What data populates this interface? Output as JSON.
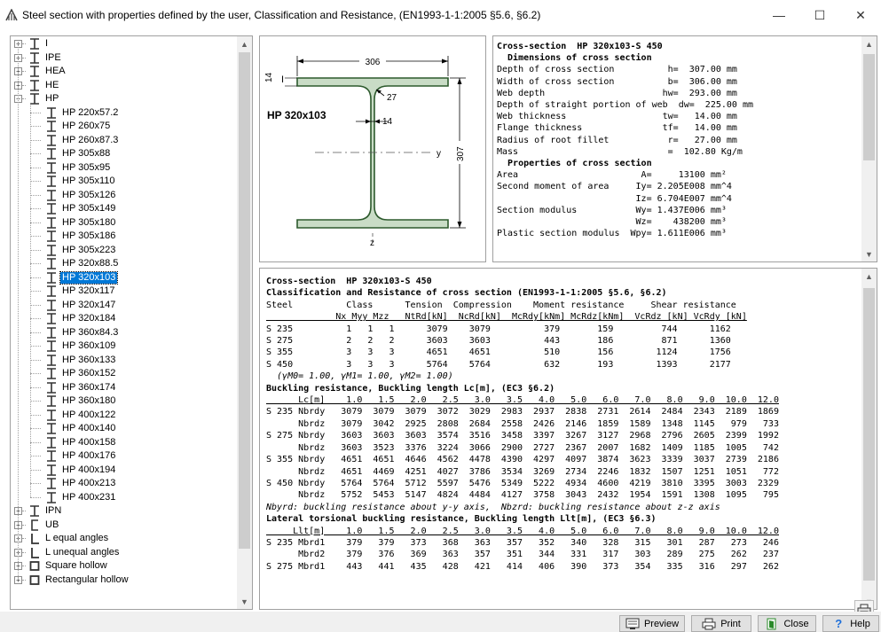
{
  "window": {
    "title": "Steel section with properties defined by the user, Classification and Resistance, (EN1993-1-1:2005 §5.6, §6.2)",
    "minimize_glyph": "—",
    "maximize_glyph": "☐",
    "close_glyph": "✕"
  },
  "tree": {
    "items": [
      {
        "label": "I",
        "level": 0,
        "toggle": "+",
        "icon": "i-beam-icon"
      },
      {
        "label": "IPE",
        "level": 0,
        "toggle": "+",
        "icon": "i-beam-icon"
      },
      {
        "label": "HEA",
        "level": 0,
        "toggle": "+",
        "icon": "i-beam-icon"
      },
      {
        "label": "HE",
        "level": 0,
        "toggle": "+",
        "icon": "i-beam-icon"
      },
      {
        "label": "HP",
        "level": 0,
        "toggle": "−",
        "icon": "i-beam-icon"
      },
      {
        "label": "HP 220x57.2",
        "level": 1,
        "icon": "i-beam-icon"
      },
      {
        "label": "HP 260x75",
        "level": 1,
        "icon": "i-beam-icon"
      },
      {
        "label": "HP 260x87.3",
        "level": 1,
        "icon": "i-beam-icon"
      },
      {
        "label": "HP 305x88",
        "level": 1,
        "icon": "i-beam-icon"
      },
      {
        "label": "HP 305x95",
        "level": 1,
        "icon": "i-beam-icon"
      },
      {
        "label": "HP 305x110",
        "level": 1,
        "icon": "i-beam-icon"
      },
      {
        "label": "HP 305x126",
        "level": 1,
        "icon": "i-beam-icon"
      },
      {
        "label": "HP 305x149",
        "level": 1,
        "icon": "i-beam-icon"
      },
      {
        "label": "HP 305x180",
        "level": 1,
        "icon": "i-beam-icon"
      },
      {
        "label": "HP 305x186",
        "level": 1,
        "icon": "i-beam-icon"
      },
      {
        "label": "HP 305x223",
        "level": 1,
        "icon": "i-beam-icon"
      },
      {
        "label": "HP 320x88.5",
        "level": 1,
        "icon": "i-beam-icon"
      },
      {
        "label": "HP 320x103",
        "level": 1,
        "icon": "i-beam-icon",
        "selected": true
      },
      {
        "label": "HP 320x117",
        "level": 1,
        "icon": "i-beam-icon"
      },
      {
        "label": "HP 320x147",
        "level": 1,
        "icon": "i-beam-icon"
      },
      {
        "label": "HP 320x184",
        "level": 1,
        "icon": "i-beam-icon"
      },
      {
        "label": "HP 360x84.3",
        "level": 1,
        "icon": "i-beam-icon"
      },
      {
        "label": "HP 360x109",
        "level": 1,
        "icon": "i-beam-icon"
      },
      {
        "label": "HP 360x133",
        "level": 1,
        "icon": "i-beam-icon"
      },
      {
        "label": "HP 360x152",
        "level": 1,
        "icon": "i-beam-icon"
      },
      {
        "label": "HP 360x174",
        "level": 1,
        "icon": "i-beam-icon"
      },
      {
        "label": "HP 360x180",
        "level": 1,
        "icon": "i-beam-icon"
      },
      {
        "label": "HP 400x122",
        "level": 1,
        "icon": "i-beam-icon"
      },
      {
        "label": "HP 400x140",
        "level": 1,
        "icon": "i-beam-icon"
      },
      {
        "label": "HP 400x158",
        "level": 1,
        "icon": "i-beam-icon"
      },
      {
        "label": "HP 400x176",
        "level": 1,
        "icon": "i-beam-icon"
      },
      {
        "label": "HP 400x194",
        "level": 1,
        "icon": "i-beam-icon"
      },
      {
        "label": "HP 400x213",
        "level": 1,
        "icon": "i-beam-icon"
      },
      {
        "label": "HP 400x231",
        "level": 1,
        "icon": "i-beam-icon"
      },
      {
        "label": "IPN",
        "level": 0,
        "toggle": "+",
        "icon": "i-beam-icon"
      },
      {
        "label": "UB",
        "level": 0,
        "toggle": "+",
        "icon": "channel-icon"
      },
      {
        "label": "L equal angles",
        "level": 0,
        "toggle": "+",
        "icon": "angle-icon"
      },
      {
        "label": "L unequal angles",
        "level": 0,
        "toggle": "+",
        "icon": "angle-icon"
      },
      {
        "label": "Square hollow",
        "level": 0,
        "toggle": "+",
        "icon": "square-hollow-icon"
      },
      {
        "label": "Rectangular hollow",
        "level": 0,
        "toggle": "+",
        "icon": "square-hollow-icon"
      }
    ]
  },
  "drawing": {
    "section_name": "HP 320x103",
    "dim_width": "306",
    "dim_flange": "14",
    "dim_radius": "27",
    "dim_web": "14",
    "dim_height": "307",
    "axis_y": "y",
    "axis_z": "z",
    "axis_marker": "I"
  },
  "properties": {
    "lines": [
      "Cross-section  HP 320x103-S 450",
      "  Dimensions of cross section",
      "Depth of cross section          h=  307.00 mm",
      "Width of cross section          b=  306.00 mm",
      "Web depth                      hw=  293.00 mm",
      "Depth of straight portion of web  dw=  225.00 mm",
      "Web thickness                  tw=   14.00 mm",
      "Flange thickness               tf=   14.00 mm",
      "Radius of root fillet           r=   27.00 mm",
      "Mass                            =  102.80 Kg/m",
      "  Properties of cross section",
      "Area                       A=     13100 mm²",
      "Second moment of area     Iy= 2.205E008 mm^4",
      "                          Iz= 6.704E007 mm^4",
      "Section modulus           Wy= 1.437E006 mm³",
      "                          Wz=    438200 mm³",
      "Plastic section modulus  Wpy= 1.611E006 mm³"
    ]
  },
  "classification": {
    "lines": [
      "Cross-section  HP 320x103-S 450",
      "Classification and Resistance of cross section (EN1993-1-1:2005 §5.6, §6.2)",
      "Steel          Class      Tension  Compression    Moment resistance     Shear resistance",
      "             Nx Myy Mzz   NtRd[kN]  NcRd[kN]  McRdy[kNm] McRdz[kNm]  VcRdz [kN] VcRdy [kN]",
      "S 235          1   1   1      3079    3079          379       159         744      1162",
      "S 275          2   2   2      3603    3603          443       186         871      1360",
      "S 355          3   3   3      4651    4651          510       156        1124      1756",
      "S 450          3   3   3      5764    5764          632       193        1393      2177",
      "  (γM0= 1.00, γM1= 1.00, γM2= 1.00)",
      "Buckling resistance, Buckling length Lc[m], (EC3 §6.2)",
      "      Lc[m]    1.0   1.5   2.0   2.5   3.0   3.5   4.0   5.0   6.0   7.0   8.0   9.0  10.0  12.0",
      "S 235 Nbrdy   3079  3079  3079  3072  3029  2983  2937  2838  2731  2614  2484  2343  2189  1869",
      "      Nbrdz   3079  3042  2925  2808  2684  2558  2426  2146  1859  1589  1348  1145   979   733",
      "S 275 Nbrdy   3603  3603  3603  3574  3516  3458  3397  3267  3127  2968  2796  2605  2399  1992",
      "      Nbrdz   3603  3523  3376  3224  3066  2900  2727  2367  2007  1682  1409  1185  1005   742",
      "S 355 Nbrdy   4651  4651  4646  4562  4478  4390  4297  4097  3874  3623  3339  3037  2739  2186",
      "      Nbrdz   4651  4469  4251  4027  3786  3534  3269  2734  2246  1832  1507  1251  1051   772",
      "S 450 Nbrdy   5764  5764  5712  5597  5476  5349  5222  4934  4600  4219  3810  3395  3003  2329",
      "      Nbrdz   5752  5453  5147  4824  4484  4127  3758  3043  2432  1954  1591  1308  1095   795",
      "Nbyrd: buckling resistance about y-y axis,  Nbzrd: buckling resistance about z-z axis",
      "Lateral torsional buckling resistance, Buckling length Llt[m], (EC3 §6.3)",
      "     Llt[m]    1.0   1.5   2.0   2.5   3.0   3.5   4.0   5.0   6.0   7.0   8.0   9.0  10.0  12.0",
      "S 235 Mbrd1    379   379   373   368   363   357   352   340   328   315   301   287   273   246",
      "      Mbrd2    379   376   369   363   357   351   344   331   317   303   289   275   262   237",
      "S 275 Mbrd1    443   441   435   428   421   414   406   390   373   354   335   316   297   262"
    ]
  },
  "buttons": {
    "preview": "Preview",
    "print": "Print",
    "close": "Close",
    "help": "Help"
  },
  "colors": {
    "selection": "#0078d7",
    "section_fill": "#c9dcc6",
    "help_icon": "#1e6fd9",
    "close_icon": "#2a8a2a"
  }
}
